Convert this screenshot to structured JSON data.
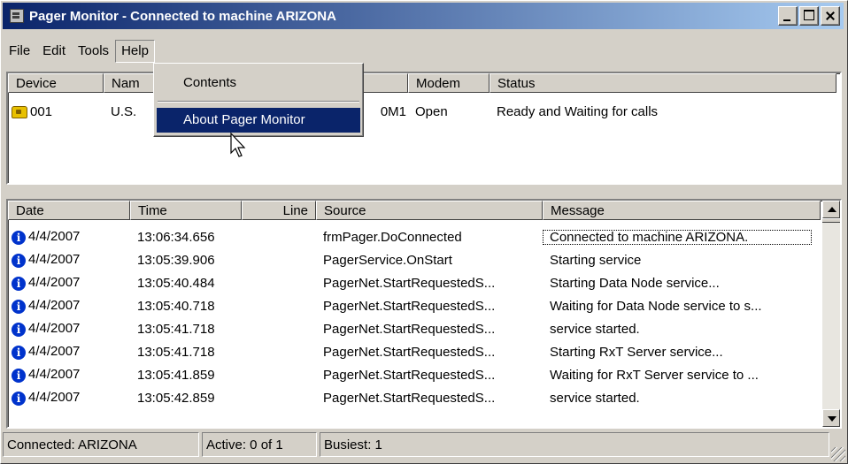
{
  "window": {
    "title": "Pager Monitor - Connected to machine ARIZONA"
  },
  "menu": [
    "File",
    "Edit",
    "Tools",
    "Help"
  ],
  "help_menu": {
    "items": [
      "Contents",
      "About Pager Monitor"
    ],
    "highlighted": "About Pager Monitor"
  },
  "devices": {
    "columns": [
      "Device",
      "Nam",
      "",
      "Modem",
      "Status"
    ],
    "rows": [
      {
        "device": "001",
        "name": "U.S.",
        "port": "0M1",
        "modem": "Open",
        "status": "Ready and Waiting for calls"
      }
    ]
  },
  "log": {
    "columns": [
      "Date",
      "Time",
      "Line",
      "Source",
      "Message"
    ],
    "rows": [
      {
        "date": "4/4/2007",
        "time": "13:06:34.656",
        "line": "",
        "source": "frmPager.DoConnected",
        "message": "Connected to machine ARIZONA."
      },
      {
        "date": "4/4/2007",
        "time": "13:05:39.906",
        "line": "",
        "source": "PagerService.OnStart",
        "message": "Starting service"
      },
      {
        "date": "4/4/2007",
        "time": "13:05:40.484",
        "line": "",
        "source": "PagerNet.StartRequestedS...",
        "message": "Starting Data Node service..."
      },
      {
        "date": "4/4/2007",
        "time": "13:05:40.718",
        "line": "",
        "source": "PagerNet.StartRequestedS...",
        "message": "Waiting for Data Node service to s..."
      },
      {
        "date": "4/4/2007",
        "time": "13:05:41.718",
        "line": "",
        "source": "PagerNet.StartRequestedS...",
        "message": "service started."
      },
      {
        "date": "4/4/2007",
        "time": "13:05:41.718",
        "line": "",
        "source": "PagerNet.StartRequestedS...",
        "message": "Starting RxT Server service..."
      },
      {
        "date": "4/4/2007",
        "time": "13:05:41.859",
        "line": "",
        "source": "PagerNet.StartRequestedS...",
        "message": "Waiting for RxT Server service to ..."
      },
      {
        "date": "4/4/2007",
        "time": "13:05:42.859",
        "line": "",
        "source": "PagerNet.StartRequestedS...",
        "message": "service started."
      }
    ]
  },
  "status": {
    "connected": "Connected: ARIZONA",
    "active": "Active: 0 of 1",
    "busiest": "Busiest: 1"
  },
  "colors": {
    "titlebar_start": "#0a246a",
    "titlebar_end": "#a6caf0",
    "highlight": "#0a246a",
    "info_icon": "#0033cc"
  }
}
